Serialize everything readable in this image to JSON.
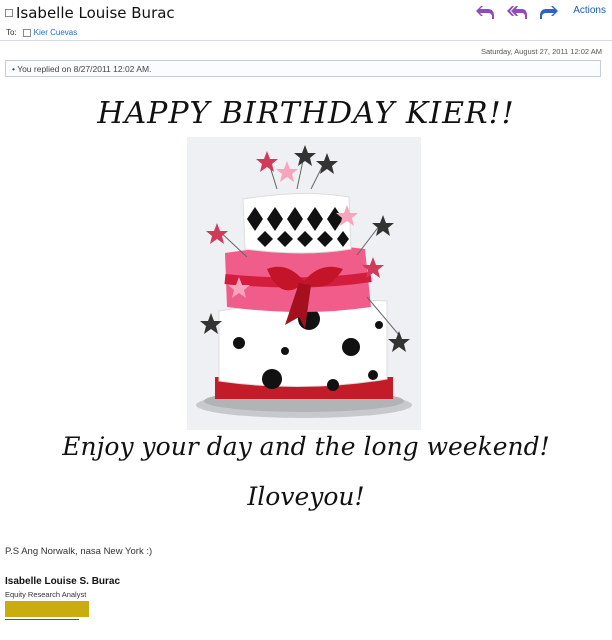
{
  "header": {
    "sender": "Isabelle Louise Burac",
    "actions_label": "Actions",
    "to_label": "To:",
    "recipient": "Kier Cuevas",
    "nav_icons": [
      "reply-icon",
      "reply-all-icon",
      "forward-icon"
    ],
    "nav_colors": [
      "#8f4bbf",
      "#8f4bbf",
      "#2b63c8"
    ]
  },
  "meta": {
    "date": "Saturday, August 27, 2011 12:02 AM",
    "reply_notice": "You replied on 8/27/2011 12:02 AM."
  },
  "body": {
    "greeting": "HAPPY BIRTHDAY KIER!!",
    "message": "Enjoy your day and the long weekend!",
    "love": "Iloveyou!",
    "ps": "P.S Ang Norwalk, nasa New York :)"
  },
  "signature": {
    "name": "Isabelle Louise S. Burac",
    "title": "Equity Research Analyst",
    "redaction_color": "#c9ac0f"
  },
  "image": {
    "subject": "three-tier birthday cake"
  }
}
